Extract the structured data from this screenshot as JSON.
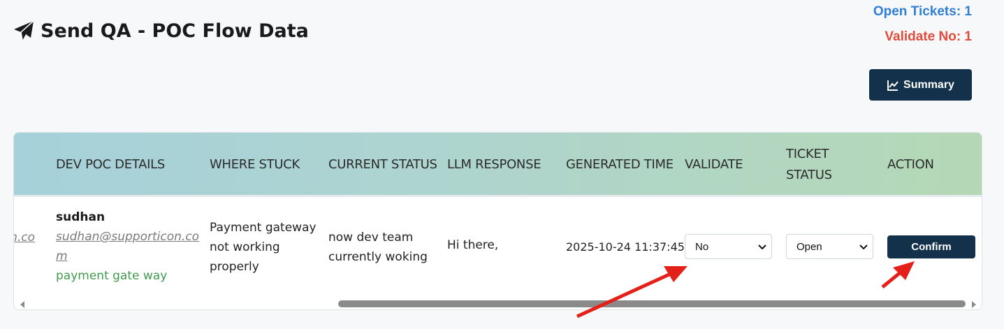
{
  "header": {
    "title": "Send QA - POC Flow Data",
    "open_tickets": "Open Tickets: 1",
    "validate_no": "Validate No: 1",
    "summary_label": "Summary"
  },
  "table": {
    "columns": [
      "DEV POC DETAILS",
      "WHERE STUCK",
      "CURRENT STATUS",
      "LLM RESPONSE",
      "GENERATED TIME",
      "VALIDATE",
      "TICKET STATUS",
      "ACTION"
    ],
    "ticket_status_line1": "TICKET",
    "ticket_status_line2": "STATUS",
    "row": {
      "clipped_email": "n.co",
      "poc_name": "sudhan",
      "poc_email_line1": "sudhan@supporticon.co",
      "poc_email_line2": "m",
      "poc_issue": "payment gate way",
      "where_stuck_line1": "Payment gateway",
      "where_stuck_line2": "not working",
      "where_stuck_line3": "properly",
      "status_line1": "now dev team",
      "status_line2": "currently woking",
      "llm_response": "Hi there,",
      "generated_time": "2025-10-24 11:37:45",
      "validate_value": "No",
      "ticket_status_value": "Open",
      "action_label": "Confirm"
    }
  },
  "colors": {
    "accent": "#14314b",
    "open_tickets": "#2f7fd6",
    "validate_no": "#e04b3c",
    "issue_green": "#3f9a4c",
    "annotation_arrow": "#e32119"
  },
  "icons": {
    "title": "paper-plane-icon",
    "summary": "line-chart-icon",
    "select": "chevron-down-icon"
  }
}
